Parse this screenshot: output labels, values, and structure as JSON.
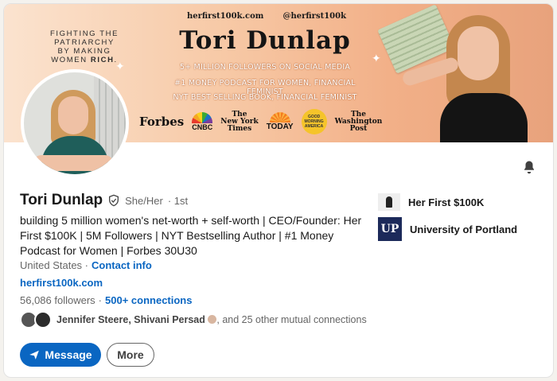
{
  "banner": {
    "tagline_lines": [
      "FIGHTING THE",
      "PATRIARCHY",
      "BY MAKING",
      "WOMEN"
    ],
    "tagline_bold": "RICH",
    "handle_site": "herfirst100k.com",
    "handle_social": "@herfirst100k",
    "title": "Tori Dunlap",
    "claims": [
      "5+ MILLION FOLLOWERS ON SOCIAL MEDIA",
      "#1 MONEY PODCAST FOR WOMEN, FINANCIAL FEMINIST",
      "NYT BEST SELLING BOOK, FINANCIAL FEMINIST"
    ],
    "logos": {
      "forbes": "Forbes",
      "cnbc": "CNBC",
      "nyt_line1": "The",
      "nyt_line2": "New York",
      "nyt_line3": "Times",
      "today": "TODAY",
      "gma": "GOOD MORNING AMERICA",
      "wp_line1": "The",
      "wp_line2": "Washington",
      "wp_line3": "Post"
    }
  },
  "profile": {
    "name": "Tori Dunlap",
    "pronouns": "She/Her",
    "degree": "· 1st",
    "headline": "building 5 million women's net-worth + self-worth | CEO/Founder: Her First $100K | 5M Followers | NYT Bestselling Author | #1 Money Podcast for Women | Forbes 30U30",
    "location": "United States ·",
    "contact_info": "Contact info",
    "website": "herfirst100k.com",
    "followers": "56,086 followers",
    "sep": " · ",
    "connections": "500+ connections",
    "mutual_names": "Jennifer Steere, Shivani Persad",
    "mutual_rest": ", and 25 other mutual connections"
  },
  "actions": {
    "message": "Message",
    "more": "More"
  },
  "sidebar": {
    "company": "Her First $100K",
    "school": "University of Portland",
    "school_logo": "UP"
  },
  "colors": {
    "accent": "#0a66c2",
    "text": "#191919",
    "muted": "#666666"
  }
}
